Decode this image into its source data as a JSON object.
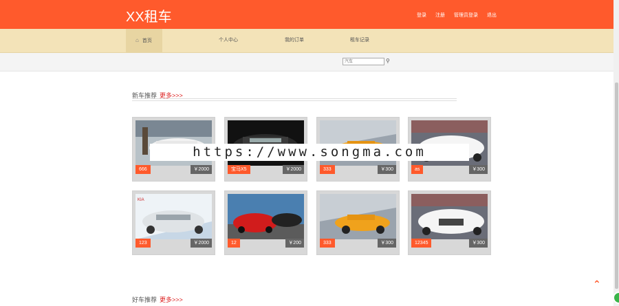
{
  "header": {
    "logo": "XX租车",
    "links": [
      "登录",
      "注册",
      "管理员登录",
      "退出"
    ],
    "brand_color": "#ff5a2c"
  },
  "nav": {
    "home": "首页",
    "items": [
      "个人中心",
      "我的订单",
      "租车记录"
    ]
  },
  "search": {
    "placeholder": "汽车",
    "icon": "search-icon"
  },
  "sections": {
    "new": {
      "title": "新车推荐",
      "more": "更多>>>"
    },
    "good": {
      "title": "好车推荐",
      "more": "更多>>>"
    }
  },
  "cars": [
    {
      "name": "666",
      "price": "￥2000",
      "style": "white-sedan"
    },
    {
      "name": "宝马X5",
      "price": "￥2000",
      "style": "black-car"
    },
    {
      "name": "333",
      "price": "￥300",
      "style": "yellow-coupe"
    },
    {
      "name": "as",
      "price": "￥300",
      "style": "white-audi"
    },
    {
      "name": "123",
      "price": "￥2000",
      "style": "kia-white"
    },
    {
      "name": "12",
      "price": "￥200",
      "style": "red-bmw"
    },
    {
      "name": "333",
      "price": "￥300",
      "style": "yellow-coupe"
    },
    {
      "name": "12345",
      "price": "￥300",
      "style": "white-audi"
    }
  ],
  "watermark": "https://www.songma.com"
}
